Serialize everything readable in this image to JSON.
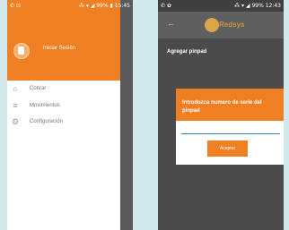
{
  "left_phone": {
    "status_left": "✆ ⊡",
    "status_right": "⁂ ▾ ◢ 99% ▮ 15:45",
    "drawer": {
      "login_label": "Iniciar Sesión",
      "items": [
        {
          "label": "Cobrar",
          "icon": "house-icon"
        },
        {
          "label": "Movimientos",
          "icon": "list-icon"
        },
        {
          "label": "Configuración",
          "icon": "gear-icon"
        }
      ]
    }
  },
  "right_phone": {
    "status_left": "✆ ✿",
    "status_right": "⁂ ▾ ◢ 99% 12:43",
    "toolbar": {
      "back_icon": "arrow-left-icon",
      "logo_text": "Redsys"
    },
    "page_heading": "Agregar pinpad",
    "dialog": {
      "title": "Introduzca numero de serie del pinpad",
      "input_value": "",
      "accept_label": "Aceptar"
    }
  },
  "colors": {
    "accent": "#ef7f22",
    "background": "#cfe9ec",
    "dark": "#4c4c4c",
    "input_line": "#2c7fbf"
  }
}
